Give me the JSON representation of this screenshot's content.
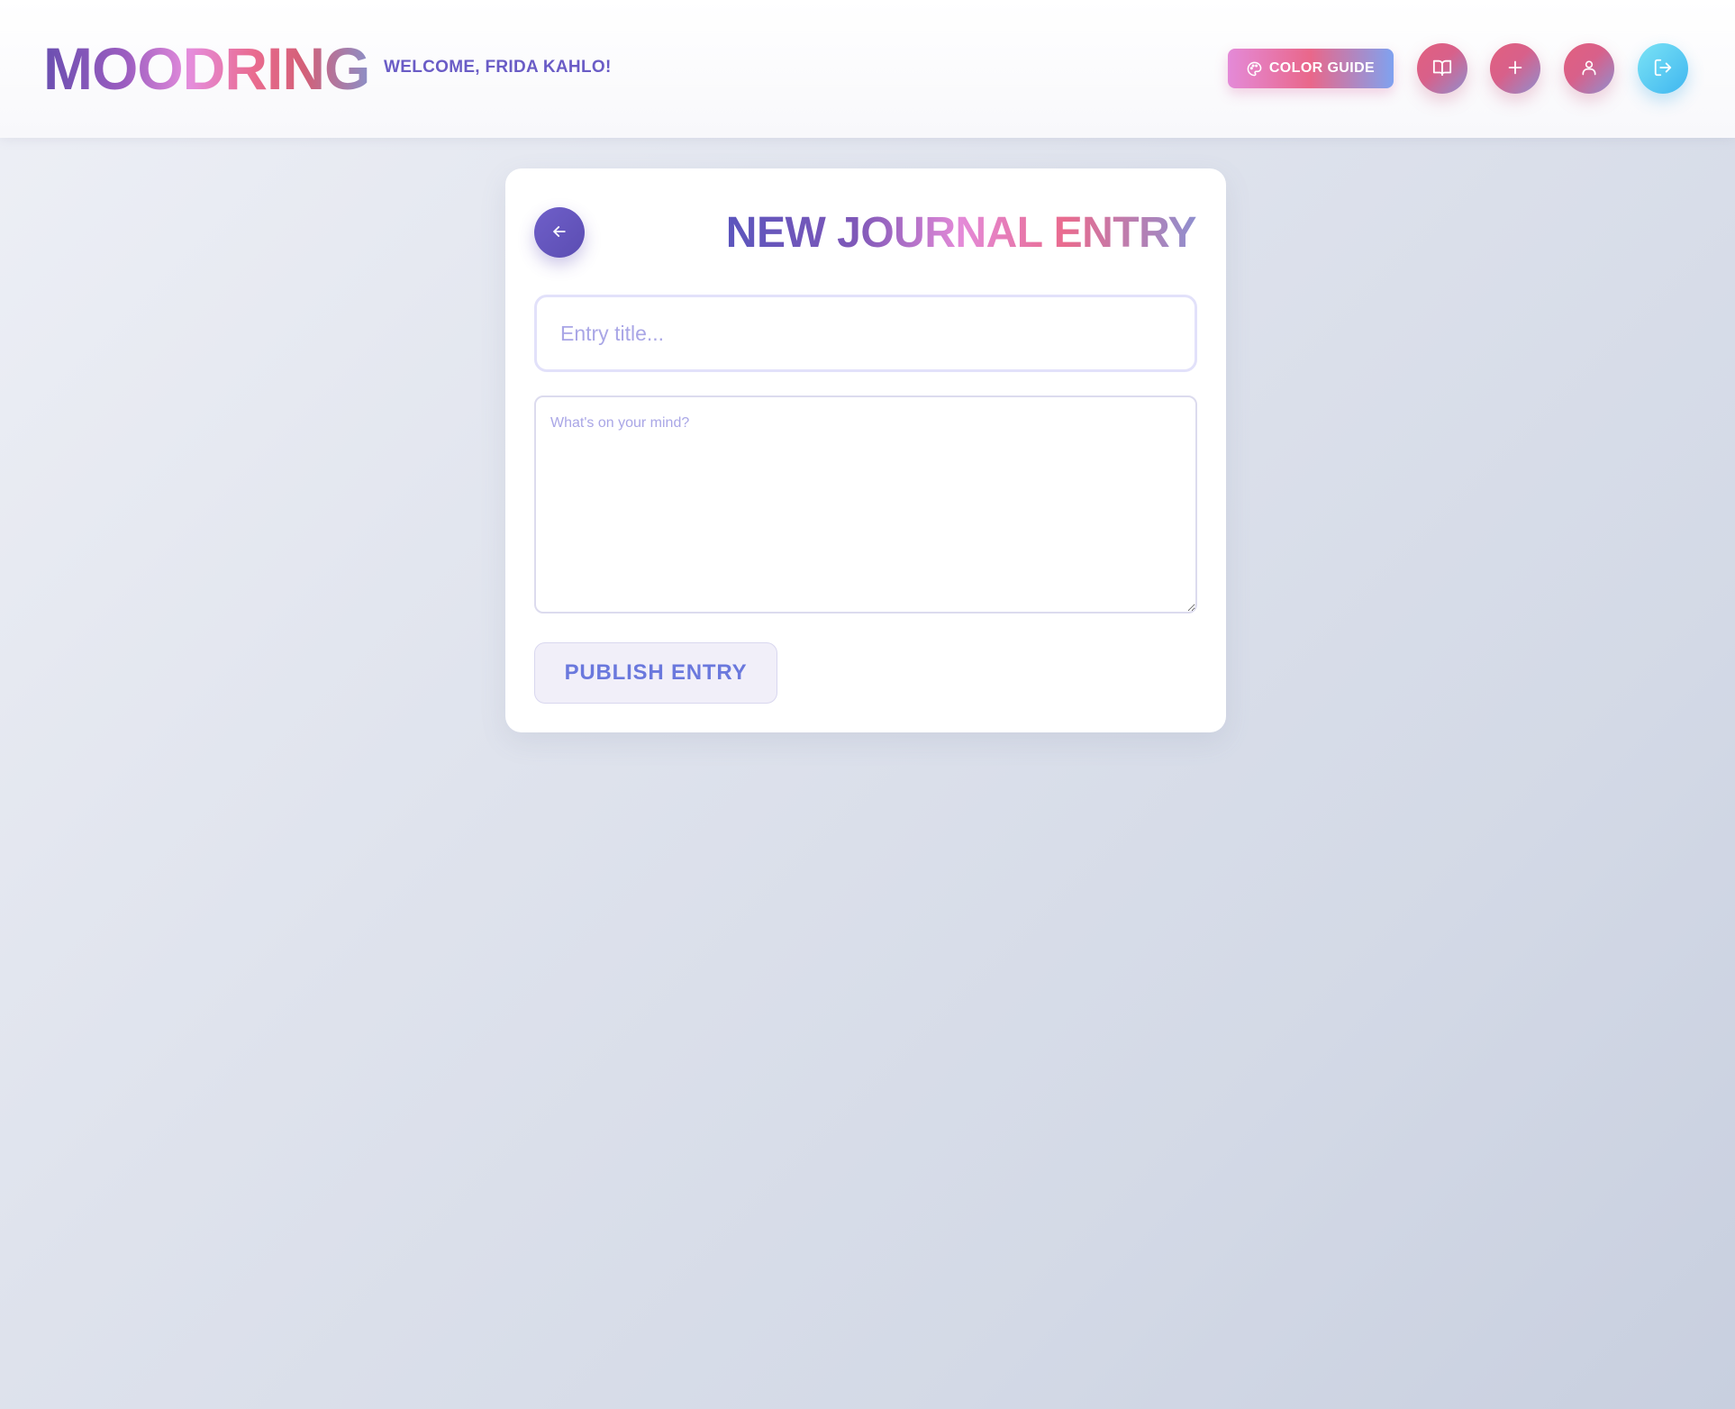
{
  "header": {
    "logo": "MOODRING",
    "welcome": "WELCOME, FRIDA KAHLO!",
    "color_guide": {
      "label": "COLOR GUIDE",
      "icon": "palette-icon"
    },
    "icon_buttons": [
      {
        "name": "journal-button",
        "icon": "book-open-icon"
      },
      {
        "name": "new-entry-button",
        "icon": "plus-icon"
      },
      {
        "name": "profile-button",
        "icon": "user-icon"
      },
      {
        "name": "logout-button",
        "icon": "log-out-icon"
      }
    ]
  },
  "entry_form": {
    "back_icon": "arrow-left-icon",
    "page_title": "NEW JOURNAL ENTRY",
    "title_field": {
      "value": "",
      "placeholder": "Entry title..."
    },
    "body_field": {
      "value": "",
      "placeholder": "What's on your mind?"
    },
    "publish_label": "PUBLISH ENTRY"
  },
  "colors": {
    "accent_purple": "#6a5cc6",
    "accent_pink": "#e9678a",
    "accent_blue": "#3fb6f0",
    "publish_text": "#6a78dd"
  }
}
